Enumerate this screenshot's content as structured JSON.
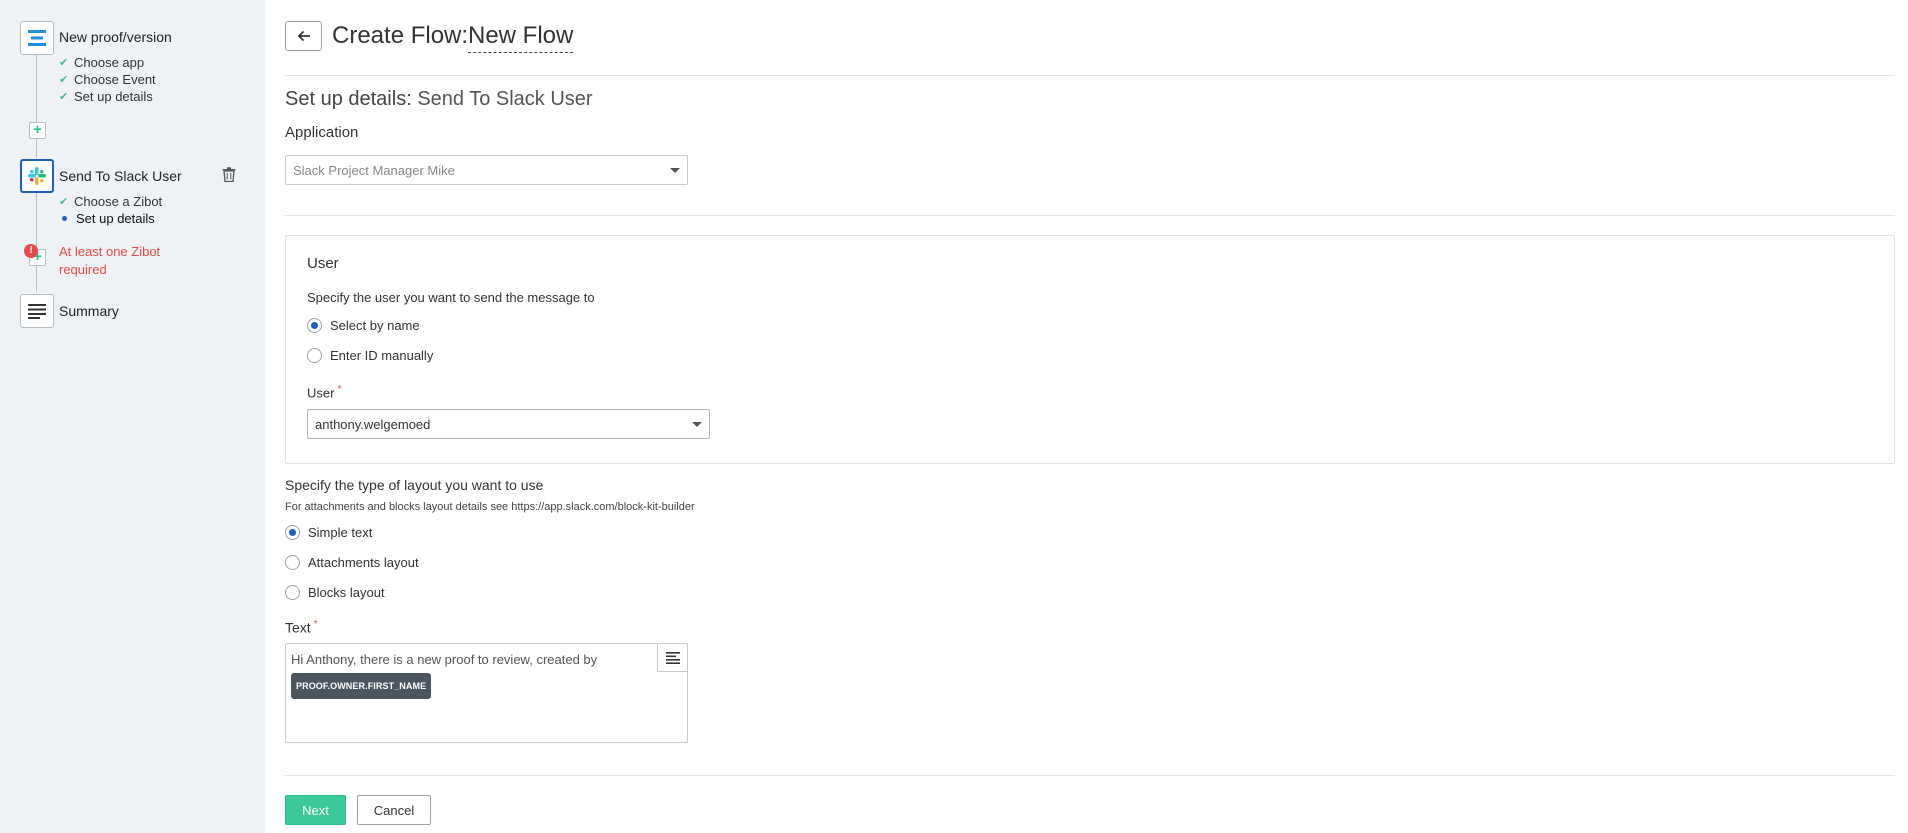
{
  "sidebar": {
    "steps": [
      {
        "title": "New proof/version",
        "icon": "proof-icon",
        "substeps": [
          "Choose app",
          "Choose Event",
          "Set up details"
        ]
      },
      {
        "title": "Send To Slack User",
        "icon": "slack-icon",
        "substeps": [
          "Choose a Zibot",
          "Set up details"
        ]
      },
      {
        "title": "Summary",
        "icon": "summary-icon"
      }
    ],
    "error_text": "At least one Zibot required",
    "error_mark": "!",
    "add_symbol": "+"
  },
  "header": {
    "title": "Create Flow:",
    "flow_name": "New Flow"
  },
  "details": {
    "heading_prefix": "Set up details:",
    "heading_value": "Send To Slack User",
    "application_label": "Application",
    "application_value": "Slack Project Manager Mike"
  },
  "user_section": {
    "title": "User",
    "prompt": "Specify the user you want to send the message to",
    "options": [
      "Select by name",
      "Enter ID manually"
    ],
    "selected_option": "Select by name",
    "user_label": "User",
    "required_mark": "*",
    "user_value": "anthony.welgemoed"
  },
  "layout_section": {
    "prompt": "Specify the type of layout you want to use",
    "note": "For attachments and blocks layout details see https://app.slack.com/block-kit-builder",
    "options": [
      "Simple text",
      "Attachments layout",
      "Blocks layout"
    ],
    "selected_option": "Simple text"
  },
  "text_section": {
    "label": "Text",
    "required_mark": "*",
    "content": "Hi Anthony, there is a new proof to review, created by",
    "token": "PROOF.OWNER.FIRST_NAME"
  },
  "actions": {
    "next_label": "Next",
    "cancel_label": "Cancel"
  },
  "colors": {
    "accent_blue": "#1f5fbf",
    "primary_green": "#3cc99a",
    "error_red": "#e84a4a",
    "sidebar_bg": "#eef2f5"
  }
}
